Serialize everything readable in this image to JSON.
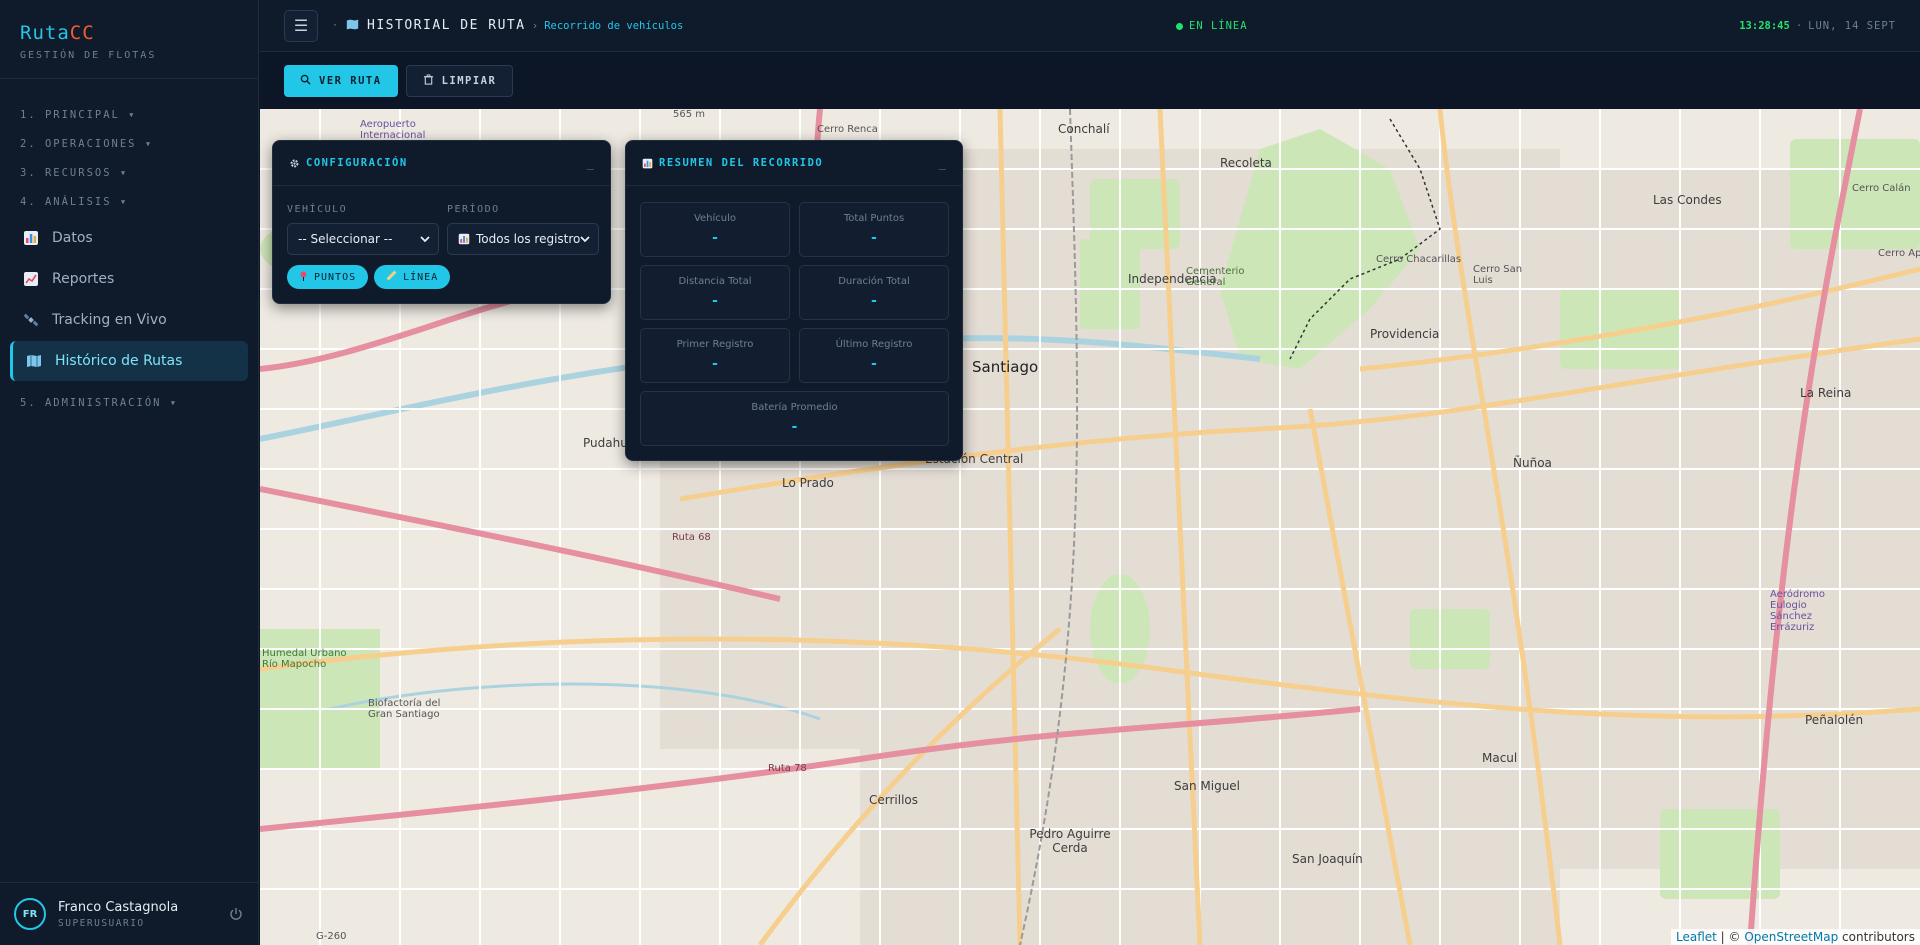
{
  "brand": {
    "name_a": "Ruta",
    "name_b": "CC",
    "subtitle": "GESTIÓN DE FLOTAS"
  },
  "sidebar": {
    "sections": [
      {
        "label": "1. PRINCIPAL ▾"
      },
      {
        "label": "2. OPERACIONES ▾"
      },
      {
        "label": "3. RECURSOS ▾"
      },
      {
        "label": "4. ANÁLISIS ▾"
      },
      {
        "label": "5. ADMINISTRACIÓN ▾"
      }
    ],
    "items": [
      {
        "label": "Datos",
        "icon": "bar-chart-icon"
      },
      {
        "label": "Reportes",
        "icon": "trend-chart-icon"
      },
      {
        "label": "Tracking en Vivo",
        "icon": "satellite-icon"
      },
      {
        "label": "Histórico de Rutas",
        "icon": "map-book-icon",
        "active": true
      }
    ]
  },
  "user": {
    "initials": "FR",
    "name": "Franco Castagnola",
    "role": "SUPERUSUARIO"
  },
  "header": {
    "title": "HISTORIAL DE RUTA",
    "subtitle": "Recorrido de vehículos",
    "status": "EN LÍNEA",
    "time": "13:28:45",
    "date": "LUN, 14 SEPT"
  },
  "toolbar": {
    "view_label": "VER RUTA",
    "clear_label": "LIMPIAR"
  },
  "config": {
    "title": "CONFIGURACIÓN",
    "minimize": "_",
    "vehicle_label": "VEHÍCULO",
    "vehicle_value": "-- Seleccionar --",
    "period_label": "PERÍODO",
    "period_value": "Todos los registros",
    "points_label": "PUNTOS",
    "line_label": "LÍNEA"
  },
  "summary": {
    "title": "RESUMEN DEL RECORRIDO",
    "minimize": "_",
    "stats": [
      {
        "label": "Vehículo",
        "value": "-"
      },
      {
        "label": "Total Puntos",
        "value": "-"
      },
      {
        "label": "Distancia Total",
        "value": "-"
      },
      {
        "label": "Duración Total",
        "value": "-"
      },
      {
        "label": "Primer Registro",
        "value": "-"
      },
      {
        "label": "Último Registro",
        "value": "-"
      },
      {
        "label": "Batería Promedio",
        "value": "-"
      }
    ]
  },
  "map": {
    "labels": {
      "santiago": "Santiago",
      "providencia": "Providencia",
      "las_condes": "Las Condes",
      "recoleta": "Recoleta",
      "conchali": "Conchalí",
      "independencia": "Independencia",
      "estacion_central": "Estación Central",
      "lo_prado": "Lo Prado",
      "nunoa": "Ñuñoa",
      "la_reina": "La Reina",
      "san_miguel": "San Miguel",
      "cerrillos": "Cerrillos",
      "pedro_aguirre_cerda": "Pedro Aguirre Cerda",
      "san_joaquin": "San Joaquín",
      "macul": "Macul",
      "penalolen": "Peñalolén",
      "pudahuel": "Pudahuel",
      "cerro_renca": "Cerro Renca",
      "cerro_chacarillas": "Cerro Chacarillas",
      "cerro_san_luis": "Cerro San Luis",
      "cementerio": "Cementerio General",
      "aeropuerto": "Aeropuerto Internacional",
      "aerodromo": "Aeródromo Eulogio Sánchez Errázuriz",
      "humedal": "Humedal Urbano Río Mapocho",
      "biofactoria": "Biofactoría del Gran Santiago",
      "cerro_calan": "Cerro Calán",
      "cerro_apoquindo": "Cerro Apoquindo",
      "ruta68": "Ruta 68",
      "ruta78": "Ruta 78",
      "g260": "G-260",
      "elevation": "565 m"
    },
    "attribution_leaflet": "Leaflet",
    "attribution_sep": " | © ",
    "attribution_osm": "OpenStreetMap",
    "attribution_tail": " contributors"
  }
}
